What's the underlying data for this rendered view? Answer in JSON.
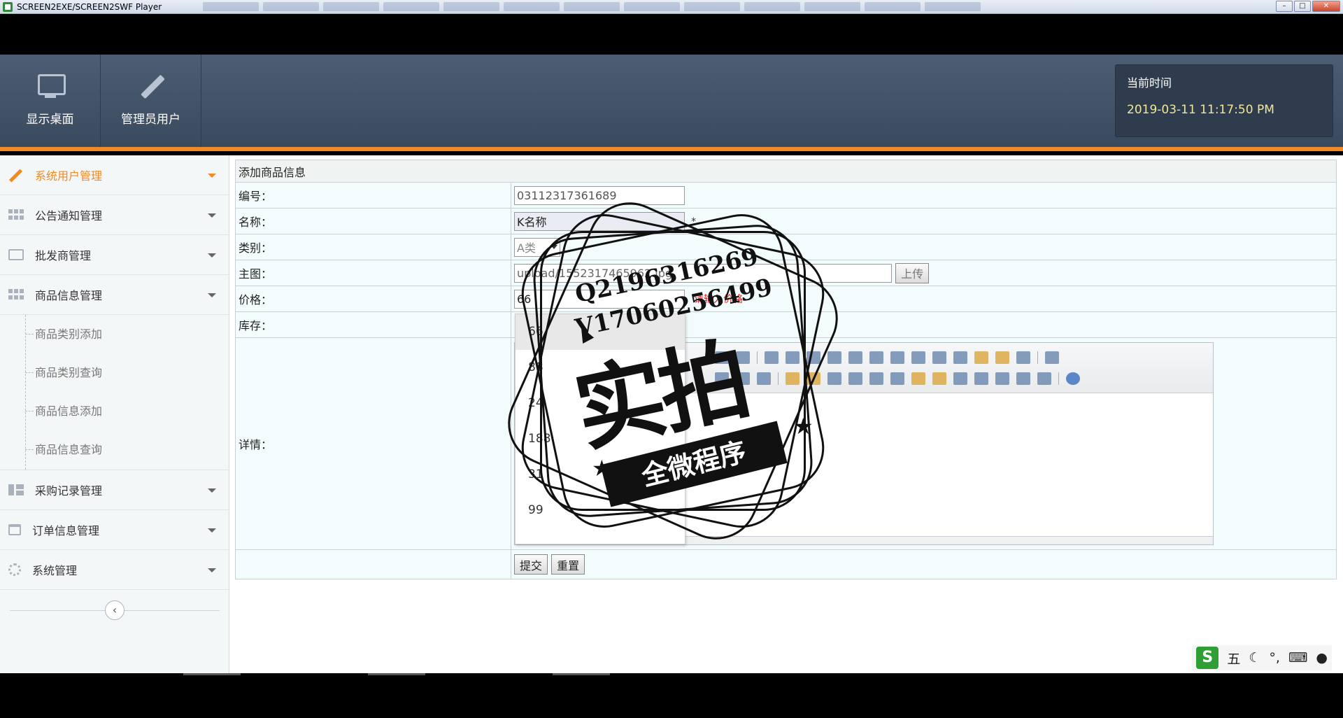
{
  "window": {
    "title": "SCREEN2EXE/SCREEN2SWF Player"
  },
  "header": {
    "buttons": [
      {
        "label": "显示桌面",
        "icon": "monitor-icon"
      },
      {
        "label": "管理员用户",
        "icon": "pencil-icon"
      }
    ],
    "time_label": "当前时间",
    "time_value": "2019-03-11 11:17:50 PM"
  },
  "sidebar": {
    "items": [
      {
        "label": "系统用户管理",
        "icon": "pencil-icon",
        "active": true
      },
      {
        "label": "公告通知管理",
        "icon": "grid-icon"
      },
      {
        "label": "批发商管理",
        "icon": "chart-icon"
      },
      {
        "label": "商品信息管理",
        "icon": "grid-icon"
      },
      {
        "label": "采购记录管理",
        "icon": "layout-icon"
      },
      {
        "label": "订单信息管理",
        "icon": "calendar-icon"
      },
      {
        "label": "系统管理",
        "icon": "gear-icon"
      }
    ],
    "subitems": [
      "商品类别添加",
      "商品类别查询",
      "商品信息添加",
      "商品信息查询"
    ],
    "collapse_label": "‹"
  },
  "form": {
    "title": "添加商品信息",
    "fields": {
      "code_label": "编号：",
      "code_value": "03112317361689",
      "name_label": "名称：",
      "name_value": "K名称",
      "name_required": "*",
      "category_label": "类别：",
      "category_value": "A类",
      "image_label": "主图：",
      "image_value": "upload/1552317465962.jpg",
      "upload_button": "上传",
      "price_label": "价格：",
      "price_value": "66",
      "price_error": "请输入价格",
      "stock_label": "库存：",
      "detail_label": "详情："
    },
    "submit_button": "提交",
    "reset_button": "重置"
  },
  "suggestions": [
    "66",
    "88",
    "24",
    "188",
    "31",
    "99"
  ],
  "ime": {
    "logo": "S",
    "mode": "五",
    "moon": "☾",
    "punct": "°,",
    "keyboard": "⌨",
    "user": "●"
  },
  "watermark": {
    "phone_q": "Q2196316269",
    "phone_v": "V17060256499",
    "big_text": "实拍",
    "ribbon_text": "全微程序",
    "star": "★"
  },
  "colors": {
    "accent": "#f08a24",
    "header_bg": "#44546a",
    "time_text": "#f0e79a",
    "error": "#dd2222"
  }
}
